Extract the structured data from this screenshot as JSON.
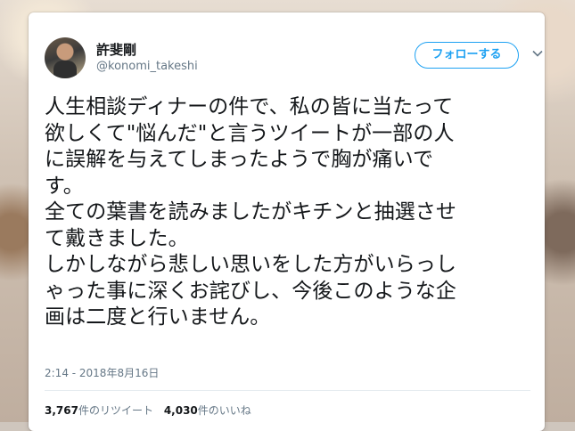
{
  "user": {
    "name": "許斐剛",
    "handle": "@konomi_takeshi"
  },
  "follow_button": {
    "label": "フォローする"
  },
  "tweet": {
    "lines": [
      "人生相談ディナーの件で、私の皆に当たって",
      "欲しくて\"悩んだ\"と言うツイートが一部の人",
      "に誤解を与えてしまったようで胸が痛いで",
      "す。",
      "全ての葉書を読みましたがキチンと抽選させ",
      "て戴きました。",
      "しかしながら悲しい思いをした方がいらっし",
      "ゃった事に深くお詫びし、今後このような企",
      "画は二度と行いません。"
    ]
  },
  "timestamp": "2:14 - 2018年8月16日",
  "stats": {
    "retweets_count": "3,767",
    "retweets_label": "件のリツイート",
    "likes_count": "4,030",
    "likes_label": "件のいいね"
  },
  "icons": {
    "menu": "chevron-down-icon"
  },
  "colors": {
    "accent": "#1da1f2",
    "text": "#14171a",
    "secondary": "#657786"
  }
}
